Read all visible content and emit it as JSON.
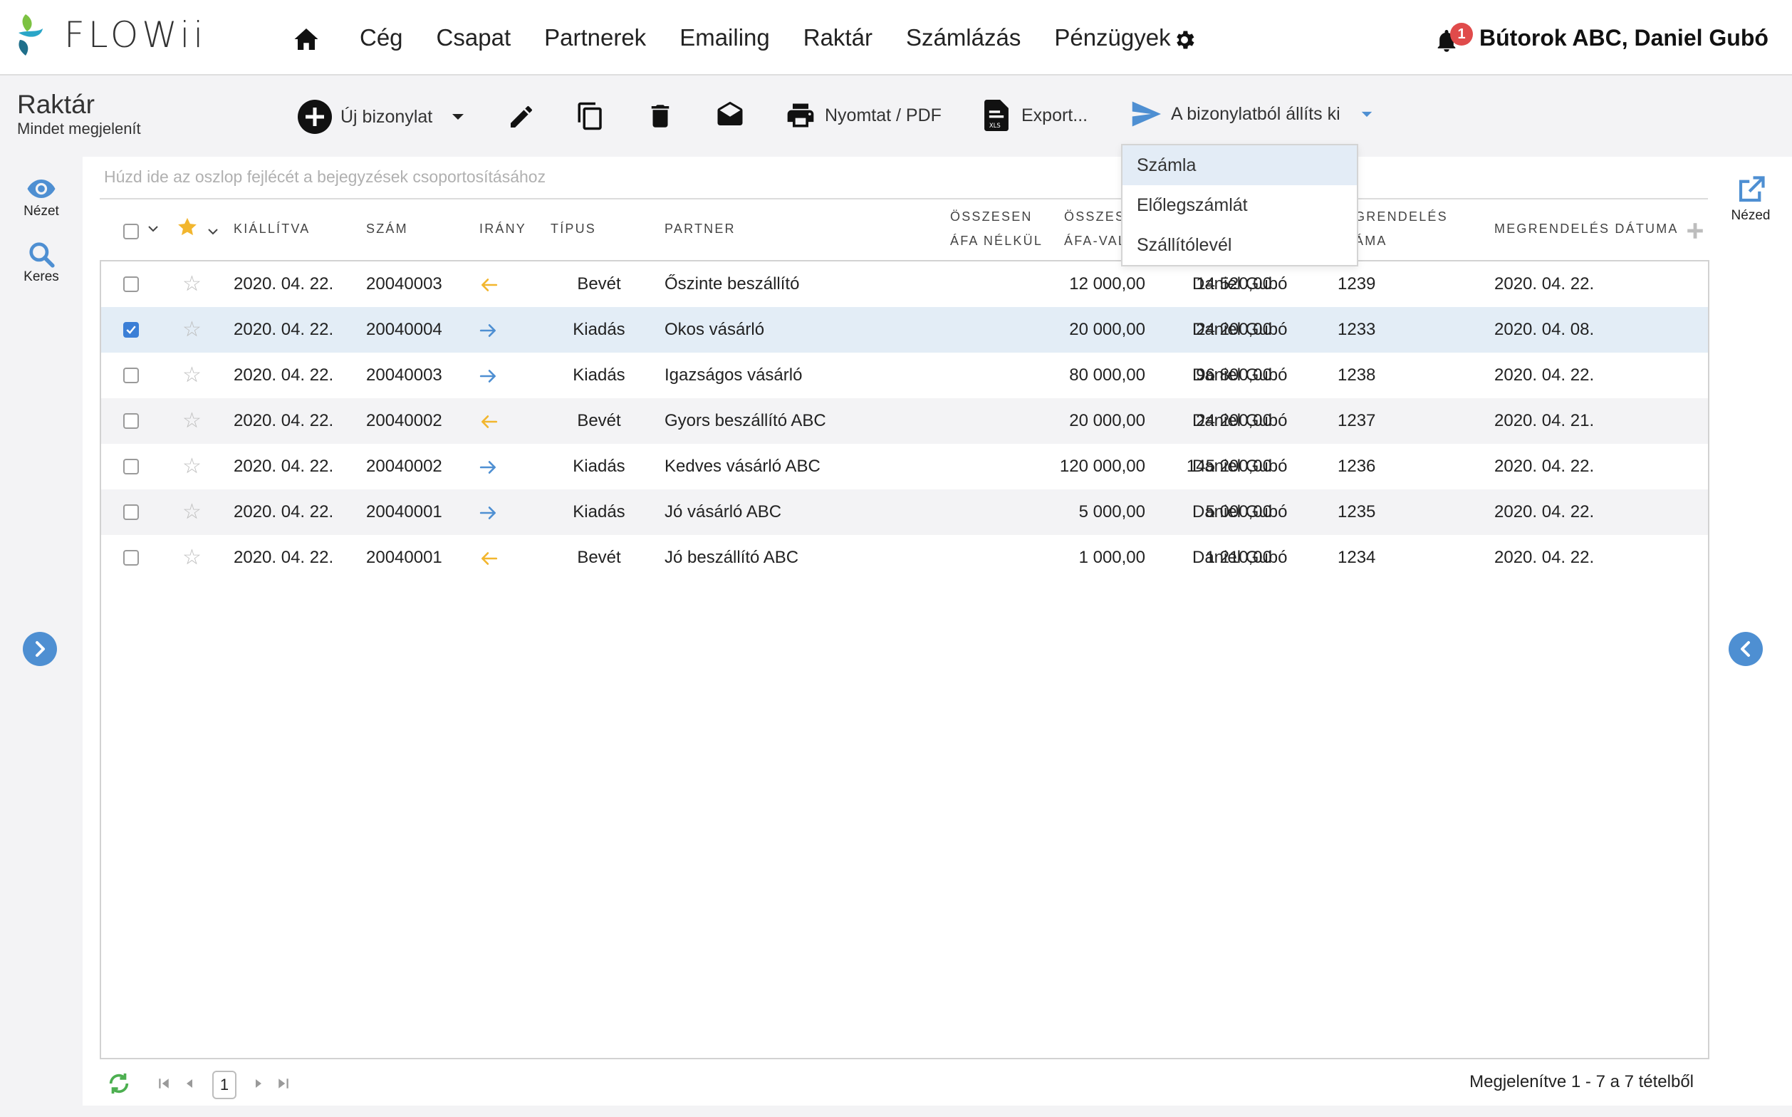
{
  "app": {
    "logo_text": "FLOWii"
  },
  "nav": {
    "items": [
      "Cég",
      "Csapat",
      "Partnerek",
      "Emailing",
      "Raktár",
      "Számlázás",
      "Pénzügyek"
    ],
    "notification_count": "1",
    "user": "Bútorok ABC, Daniel Gubó"
  },
  "page": {
    "title": "Raktár",
    "subtitle": "Mindet megjelenít"
  },
  "toolbar": {
    "new_doc": "Új bizonylat",
    "print": "Nyomtat / PDF",
    "export": "Export...",
    "issue_from": "A bizonylatból állíts ki"
  },
  "dropdown": {
    "items": [
      "Számla",
      "Előlegszámlát",
      "Szállítólevél"
    ]
  },
  "rail": {
    "view": "Nézet",
    "search": "Keres",
    "right_view": "Nézed"
  },
  "grid": {
    "group_hint": "Húzd ide az oszlop fejlécét a bejegyzések csoportosításához",
    "headers": {
      "issued": "KIÁLLÍTVA",
      "number": "SZÁM",
      "direction": "IRÁNY",
      "type": "TÍPUS",
      "partner": "PARTNER",
      "net_1": "ÖSSZESEN",
      "net_2": "ÁFA NÉLKÜL",
      "gross_1": "ÖSSZES",
      "gross_2": "ÁFA-VAL",
      "order_1": "GRENDELÉS",
      "order_2": "ÁMA",
      "order_date": "MEGRENDELÉS DÁTUMA"
    },
    "rows": [
      {
        "checked": false,
        "issued": "2020. 04. 22.",
        "number": "20040003",
        "direction": "in",
        "type": "Bevét",
        "partner": "Őszinte beszállító",
        "net": "12 000,00",
        "gross": "14 520,00",
        "user": "Daniel Gubó",
        "order_no": "1239",
        "order_date": "2020. 04. 22."
      },
      {
        "checked": true,
        "issued": "2020. 04. 22.",
        "number": "20040004",
        "direction": "out",
        "type": "Kiadás",
        "partner": "Okos vásárló",
        "net": "20 000,00",
        "gross": "24 200,00",
        "user": "Daniel Gubó",
        "order_no": "1233",
        "order_date": "2020. 04. 08."
      },
      {
        "checked": false,
        "issued": "2020. 04. 22.",
        "number": "20040003",
        "direction": "out",
        "type": "Kiadás",
        "partner": "Igazságos vásárló",
        "net": "80 000,00",
        "gross": "96 800,00",
        "user": "Daniel Gubó",
        "order_no": "1238",
        "order_date": "2020. 04. 22."
      },
      {
        "checked": false,
        "issued": "2020. 04. 22.",
        "number": "20040002",
        "direction": "in",
        "type": "Bevét",
        "partner": "Gyors beszállító ABC",
        "net": "20 000,00",
        "gross": "24 200,00",
        "user": "Daniel Gubó",
        "order_no": "1237",
        "order_date": "2020. 04. 21."
      },
      {
        "checked": false,
        "issued": "2020. 04. 22.",
        "number": "20040002",
        "direction": "out",
        "type": "Kiadás",
        "partner": "Kedves vásárló ABC",
        "net": "120 000,00",
        "gross": "145 200,00",
        "user": "Daniel Gubó",
        "order_no": "1236",
        "order_date": "2020. 04. 22."
      },
      {
        "checked": false,
        "issued": "2020. 04. 22.",
        "number": "20040001",
        "direction": "out",
        "type": "Kiadás",
        "partner": "Jó vásárló ABC",
        "net": "5 000,00",
        "gross": "5 000,00",
        "user": "Daniel Gubó",
        "order_no": "1235",
        "order_date": "2020. 04. 22."
      },
      {
        "checked": false,
        "issued": "2020. 04. 22.",
        "number": "20040001",
        "direction": "in",
        "type": "Bevét",
        "partner": "Jó beszállító ABC",
        "net": "1 000,00",
        "gross": "1 210,00",
        "user": "Daniel Gubó",
        "order_no": "1234",
        "order_date": "2020. 04. 22."
      }
    ]
  },
  "pager": {
    "current_page": "1",
    "info": "Megjelenítve 1 - 7 a 7 tételből"
  },
  "colors": {
    "accent": "#3b7fd6",
    "incoming": "#f2b62e",
    "outgoing": "#4e8fd2",
    "badge": "#e04b4b",
    "selected_row": "#e3edf6"
  },
  "icons": [
    "home-icon",
    "gear-icon",
    "bell-icon",
    "plus-circle-icon",
    "pencil-icon",
    "copy-icon",
    "trash-icon",
    "envelope-open-icon",
    "printer-icon",
    "xls-file-icon",
    "send-icon",
    "eye-icon",
    "search-icon",
    "external-link-icon",
    "refresh-icon"
  ]
}
